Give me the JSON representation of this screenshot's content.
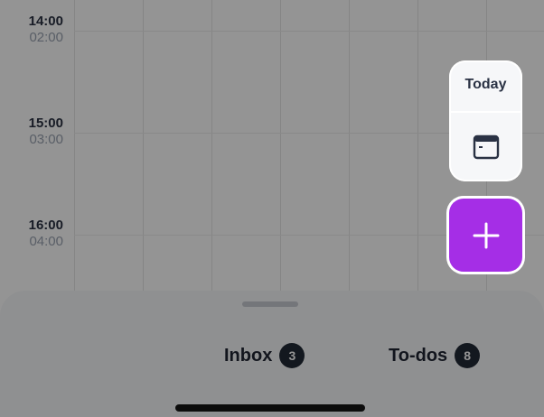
{
  "timeline": {
    "rows": [
      {
        "time24": "14:00",
        "time12": "02:00"
      },
      {
        "time24": "15:00",
        "time12": "03:00"
      },
      {
        "time24": "16:00",
        "time12": "04:00"
      }
    ]
  },
  "floating": {
    "today_label": "Today",
    "calendar_icon": "calendar-icon",
    "add_icon": "plus-icon",
    "fab_color": "#a52ee6"
  },
  "sheet": {
    "tabs": [
      {
        "label": "Inbox",
        "count": "3"
      },
      {
        "label": "To-dos",
        "count": "8"
      }
    ]
  }
}
